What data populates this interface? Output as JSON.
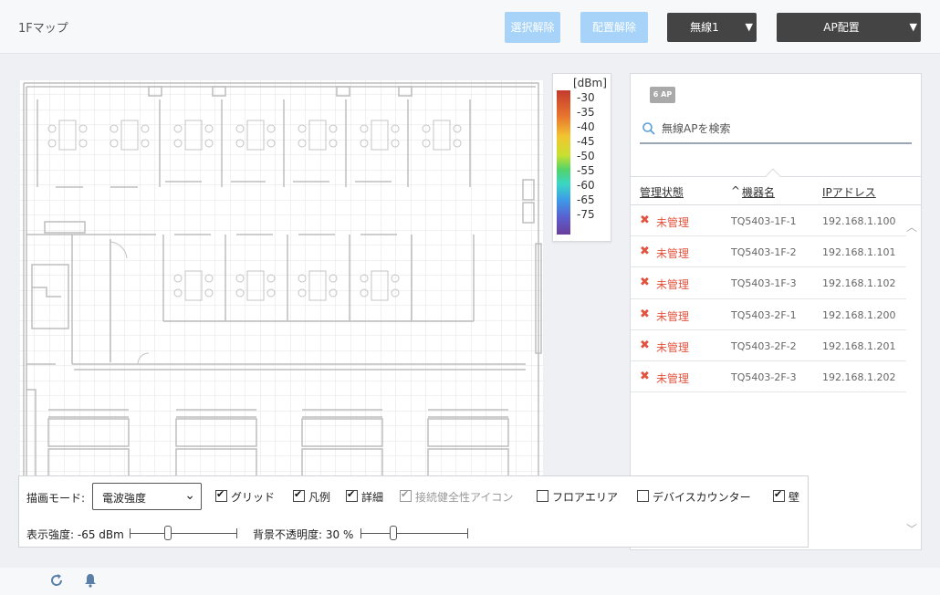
{
  "header": {
    "title": "1Fマップ",
    "deselect_label": "選択解除",
    "unplace_label": "配置解除",
    "radio_dropdown": "無線1",
    "ap_dropdown": "AP配置"
  },
  "legend": {
    "unit": "[dBm]",
    "ticks": [
      "-30",
      "-35",
      "-40",
      "-45",
      "-50",
      "-55",
      "-60",
      "-65",
      "-75"
    ]
  },
  "panel": {
    "ap_count": "6 AP",
    "search_placeholder": "無線APを検索",
    "columns": {
      "status": "管理状態",
      "name": "機器名",
      "ip": "IPアドレス"
    },
    "rows": [
      {
        "status": "未管理",
        "name": "TQ5403-1F-1",
        "ip": "192.168.1.100"
      },
      {
        "status": "未管理",
        "name": "TQ5403-1F-2",
        "ip": "192.168.1.101"
      },
      {
        "status": "未管理",
        "name": "TQ5403-1F-3",
        "ip": "192.168.1.102"
      },
      {
        "status": "未管理",
        "name": "TQ5403-2F-1",
        "ip": "192.168.1.200"
      },
      {
        "status": "未管理",
        "name": "TQ5403-2F-2",
        "ip": "192.168.1.201"
      },
      {
        "status": "未管理",
        "name": "TQ5403-2F-3",
        "ip": "192.168.1.202"
      }
    ]
  },
  "controls": {
    "mode_label": "描画モード:",
    "mode_value": "電波強度",
    "checkboxes": [
      {
        "label": "グリッド",
        "checked": true,
        "disabled": false
      },
      {
        "label": "凡例",
        "checked": true,
        "disabled": false
      },
      {
        "label": "詳細",
        "checked": true,
        "disabled": false
      },
      {
        "label": "接続健全性アイコン",
        "checked": true,
        "disabled": true
      },
      {
        "label": "フロアエリア",
        "checked": false,
        "disabled": false
      },
      {
        "label": "デバイスカウンター",
        "checked": false,
        "disabled": false
      },
      {
        "label": "壁",
        "checked": true,
        "disabled": false
      }
    ],
    "strength_label": "表示強度: -65 dBm",
    "opacity_label": "背景不透明度: 30 %"
  }
}
